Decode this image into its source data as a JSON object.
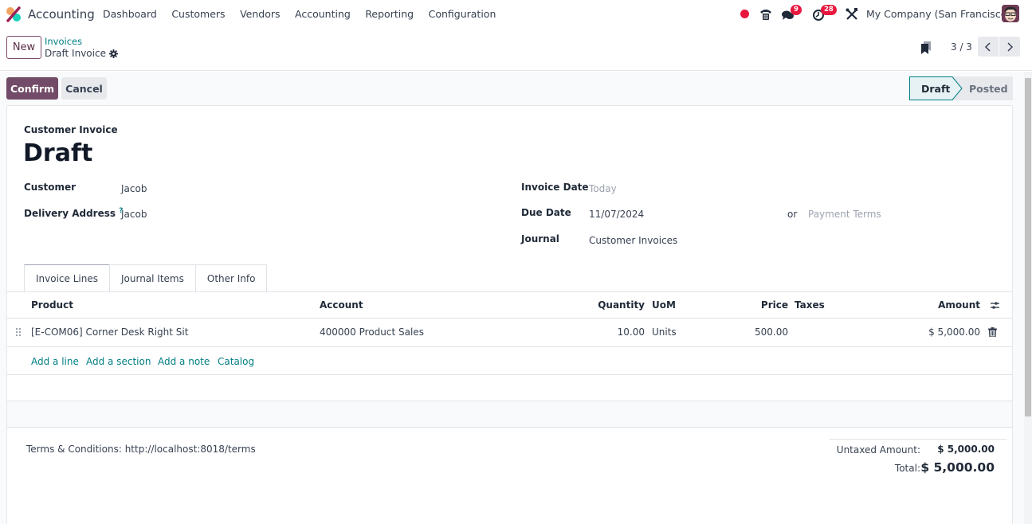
{
  "navbar": {
    "app_name": "Accounting",
    "menu": [
      "Dashboard",
      "Customers",
      "Vendors",
      "Accounting",
      "Reporting",
      "Configuration"
    ],
    "messages_badge": "9",
    "activities_badge": "28",
    "company": "My Company (San Francisco)",
    "colors": {
      "badge": "#e8173e",
      "brand": "#714b67"
    }
  },
  "control_panel": {
    "new_label": "New",
    "breadcrumb_parent": "Invoices",
    "breadcrumb_current": "Draft Invoice",
    "pager": "3 / 3"
  },
  "statusbar": {
    "confirm_label": "Confirm",
    "cancel_label": "Cancel",
    "stages": [
      {
        "label": "Draft",
        "active": true
      },
      {
        "label": "Posted",
        "active": false
      }
    ]
  },
  "form": {
    "subtitle": "Customer Invoice",
    "title": "Draft",
    "customer_label": "Customer",
    "customer_value": "Jacob",
    "delivery_label": "Delivery Address",
    "delivery_help": "?",
    "delivery_value": "Jacob",
    "invoice_date_label": "Invoice Date",
    "invoice_date_placeholder": "Today",
    "due_date_label": "Due Date",
    "due_date_value": "11/07/2024",
    "or_label": "or",
    "payment_terms_placeholder": "Payment Terms",
    "journal_label": "Journal",
    "journal_value": "Customer Invoices"
  },
  "tabs": [
    {
      "label": "Invoice Lines",
      "active": true
    },
    {
      "label": "Journal Items",
      "active": false
    },
    {
      "label": "Other Info",
      "active": false
    }
  ],
  "lines": {
    "columns": {
      "product": "Product",
      "account": "Account",
      "quantity": "Quantity",
      "uom": "UoM",
      "price": "Price",
      "taxes": "Taxes",
      "amount": "Amount"
    },
    "rows": [
      {
        "product": "[E-COM06] Corner Desk Right Sit",
        "account": "400000 Product Sales",
        "quantity": "10.00",
        "uom": "Units",
        "price": "500.00",
        "taxes": "",
        "amount": "$ 5,000.00"
      }
    ],
    "add_links": [
      "Add a line",
      "Add a section",
      "Add a note",
      "Catalog"
    ]
  },
  "footer": {
    "terms": "Terms & Conditions: http://localhost:8018/terms",
    "untaxed_label": "Untaxed Amount:",
    "untaxed_value": "$ 5,000.00",
    "total_label": "Total:",
    "total_value": "$ 5,000.00"
  }
}
